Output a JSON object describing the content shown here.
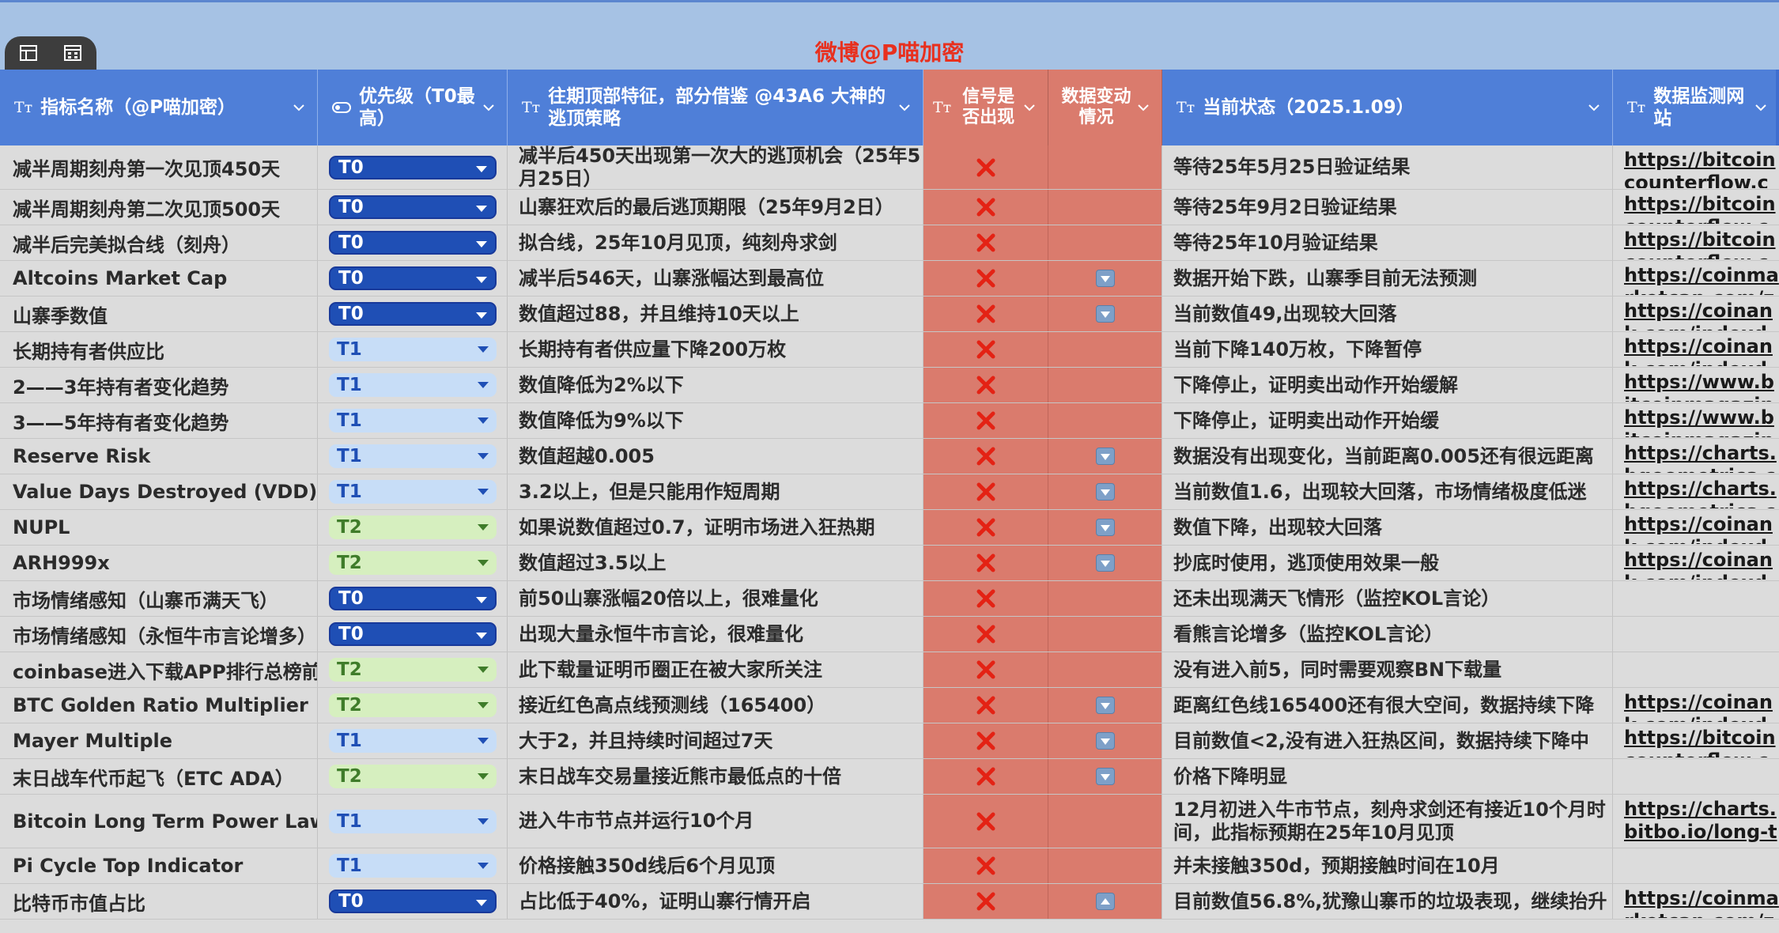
{
  "banner": {
    "title": "微博@P喵加密"
  },
  "headers": {
    "name": "指标名称（@P喵加密）",
    "priority": "优先级（T0最高）",
    "feature": "往期顶部特征，部分借鉴 @43A6 大神的逃顶策略",
    "signal": "信号是否出现",
    "change": "数据变动情况",
    "status": "当前状态（2025.1.09）",
    "site": "数据监测网站"
  },
  "icons": {
    "text_type": "Tт"
  },
  "colors": {
    "header_blue": "#4f7fd8",
    "signal_red": "#da7b6d",
    "title_red": "#e8301e",
    "T0": "#1f4fb5",
    "T1": "#c7ddf7",
    "T2": "#d6efbf"
  },
  "rows": [
    {
      "name": "减半周期刻舟第一次见顶450天",
      "priority": "T0",
      "feature": "减半后450天出现第一次大的逃顶机会（25年5月25日）",
      "signal": "x",
      "change": "",
      "status": "等待25年5月25日验证结果",
      "site": "https://bitcoincounterflow.co"
    },
    {
      "name": "减半周期刻舟第二次见顶500天",
      "priority": "T0",
      "feature": "山寨狂欢后的最后逃顶期限（25年9月2日）",
      "signal": "x",
      "change": "",
      "status": "等待25年9月2日验证结果",
      "site": "https://bitcoincounterflow.co"
    },
    {
      "name": "减半后完美拟合线（刻舟）",
      "priority": "T0",
      "feature": "拟合线，25年10月见顶，纯刻舟求剑",
      "signal": "x",
      "change": "",
      "status": "等待25年10月验证结果",
      "site": "https://bitcoincounterflow.co"
    },
    {
      "name": "Altcoins Market Cap",
      "priority": "T0",
      "feature": "减半后546天，山寨涨幅达到最高位",
      "signal": "x",
      "change": "down",
      "status": "数据开始下跌，山寨季目前无法预测",
      "site": "https://coinmarketcap.com/zh"
    },
    {
      "name": "山寨季数值",
      "priority": "T0",
      "feature": "数值超过88，并且维持10天以上",
      "signal": "x",
      "change": "down",
      "status": "当前数值49,出现较大回落",
      "site": "https://coinank.com/indexdata"
    },
    {
      "name": "长期持有者供应比",
      "priority": "T1",
      "feature": "长期持有者供应量下降200万枚",
      "signal": "x",
      "change": "",
      "status": "当前下降140万枚，下降暂停",
      "site": "https://coinank.com/indexdata"
    },
    {
      "name": "2——3年持有者变化趋势",
      "priority": "T1",
      "feature": "数值降低为2%以下",
      "signal": "x",
      "change": "",
      "status": "下降停止，证明卖出动作开始缓解",
      "site": "https://www.bitcoinmagazine"
    },
    {
      "name": "3——5年持有者变化趋势",
      "priority": "T1",
      "feature": "数值降低为9%以下",
      "signal": "x",
      "change": "",
      "status": "下降停止，证明卖出动作开始缓",
      "site": "https://www.bitcoinmagazine"
    },
    {
      "name": "Reserve Risk",
      "priority": "T1",
      "feature": "数值超越0.005",
      "signal": "x",
      "change": "down",
      "status": "数据没有出现变化，当前距离0.005还有很远距离",
      "site": "https://charts.bgeometrics.c"
    },
    {
      "name": "Value Days Destroyed (VDD)",
      "priority": "T1",
      "feature": "3.2以上，但是只能用作短周期",
      "signal": "x",
      "change": "down",
      "status": "当前数值1.6，出现较大回落，市场情绪极度低迷",
      "site": "https://charts.bgeometrics.c"
    },
    {
      "name": "NUPL",
      "priority": "T2",
      "feature": "如果说数值超过0.7，证明市场进入狂热期",
      "signal": "x",
      "change": "down",
      "status": "数值下降，出现较大回落",
      "site": "https://coinank.com/indexdata"
    },
    {
      "name": "ARH999x",
      "priority": "T2",
      "feature": "数值超过3.5以上",
      "signal": "x",
      "change": "down",
      "status": "抄底时使用，逃顶使用效果一般",
      "site": "https://coinank.com/indexdata"
    },
    {
      "name": "市场情绪感知（山寨币满天飞）",
      "priority": "T0",
      "feature": "前50山寨涨幅20倍以上，很难量化",
      "signal": "x",
      "change": "",
      "status": "还未出现满天飞情形（监控KOL言论）",
      "site": ""
    },
    {
      "name": "市场情绪感知（永恒牛市言论增多）",
      "priority": "T0",
      "feature": "出现大量永恒牛市言论，很难量化",
      "signal": "x",
      "change": "",
      "status": "看熊言论增多（监控KOL言论）",
      "site": ""
    },
    {
      "name": "coinbase进入下载APP排行总榜前5",
      "priority": "T2",
      "feature": "此下载量证明币圈正在被大家所关注",
      "signal": "x",
      "change": "",
      "status": "没有进入前5，同时需要观察BN下载量",
      "site": ""
    },
    {
      "name": "BTC Golden Ratio Multiplier",
      "priority": "T2",
      "feature": "接近红色高点线预测线（165400）",
      "signal": "x",
      "change": "down",
      "status": "距离红色线165400还有很大空间，数据持续下降",
      "site": "https://coinank.com/indexdata"
    },
    {
      "name": "Mayer Multiple",
      "priority": "T1",
      "feature": "大于2，并且持续时间超过7天",
      "signal": "x",
      "change": "down",
      "status": "目前数值<2,没有进入狂热区间，数据持续下降中",
      "site": "https://bitcoincounterflow.co"
    },
    {
      "name": "末日战车代币起飞（ETC ADA）",
      "priority": "T2",
      "feature": "末日战车交易量接近熊市最低点的十倍",
      "signal": "x",
      "change": "down",
      "status": "价格下降明显",
      "site": ""
    },
    {
      "name": "Bitcoin Long Term Power Law",
      "priority": "T1",
      "feature": "进入牛市节点并运行10个月",
      "signal": "x",
      "change": "",
      "status": "12月初进入牛市节点，刻舟求剑还有接近10个月时间，此指标预期在25年10月见顶",
      "site": "https://charts.bitbo.io/long-te"
    },
    {
      "name": "Pi Cycle Top Indicator",
      "priority": "T1",
      "feature": "价格接触350d线后6个月见顶",
      "signal": "x",
      "change": "",
      "status": "并未接触350d，预期接触时间在10月",
      "site": ""
    },
    {
      "name": "比特币市值占比",
      "priority": "T0",
      "feature": "占比低于40%，证明山寨行情开启",
      "signal": "x",
      "change": "up",
      "status": "目前数值56.8%,犹豫山寨币的垃圾表现，继续抬升",
      "site": "https://coinmarketcap.com/zh"
    }
  ]
}
